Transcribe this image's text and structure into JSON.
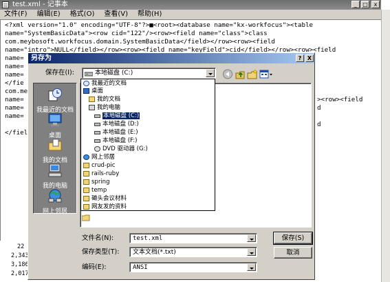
{
  "notepad": {
    "title": "test.xml - 记事本",
    "menu": [
      "文件(F)",
      "编辑(E)",
      "格式(O)",
      "查看(V)",
      "帮助(H)"
    ],
    "lines": [
      "<?xml version=\"1.0\" encoding=\"UTF-8\"?>■<root><database name=\"kx-workfocus\"><table",
      "name=\"SystemBasicData\"><row cid=\"122\"/><row><field name=\"class\">class",
      "com.meybosoft.workfocus.domain.SystemBasicData</field></row><row><field",
      "name=\"intro\">NULL</field></row><row><field name=\"keyField\">cid</field></row><row><field",
      "name=",
      "name=",
      "name=",
      "</fie",
      "com.me",
      "name=",
      "name=",
      "name=",
      "</fiel"
    ],
    "right_fragments": [
      "><row><field",
      "d",
      "d"
    ],
    "bottom_numbers": [
      "22",
      "2,343",
      "3,186",
      "2,017"
    ]
  },
  "dialog": {
    "title": "另存为",
    "help": "?",
    "close": "X",
    "save_in_label": "保存在(I):",
    "save_in_value": "本地磁盘 (C:)",
    "places": [
      {
        "label": "我最近的文档",
        "icon": "recent-documents-icon"
      },
      {
        "label": "桌面",
        "icon": "desktop-icon"
      },
      {
        "label": "我的文档",
        "icon": "my-documents-icon"
      },
      {
        "label": "我的电脑",
        "icon": "my-computer-icon"
      },
      {
        "label": "网上邻居",
        "icon": "network-places-icon"
      }
    ],
    "location_list": [
      "我最近的文档",
      "桌面",
      "我的文档",
      "我的电脑",
      "本地磁盘 (C:)",
      "本地磁盘 (D:)",
      "本地磁盘 (E:)",
      "本地磁盘 (F:)",
      "DVD 驱动器 (G:)",
      "网上邻居",
      "crud-pic",
      "rails-ruby",
      "spring",
      "temp",
      "磡头会议材料",
      "网友发的资料"
    ],
    "filename_label": "文件名(N):",
    "filename_value": "test.xml",
    "filetype_label": "保存类型(T):",
    "filetype_value": "文本文档(*.txt)",
    "encoding_label": "编码(E):",
    "encoding_value": "ANSI",
    "save_button": "保存(S)",
    "cancel_button": "取消"
  }
}
